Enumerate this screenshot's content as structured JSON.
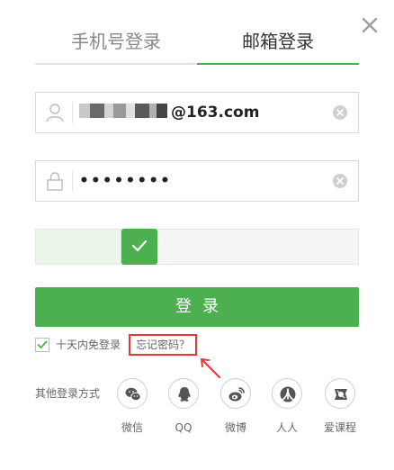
{
  "tabs": [
    {
      "label": "手机号登录",
      "active": false
    },
    {
      "label": "邮箱登录",
      "active": true
    }
  ],
  "email_field": {
    "value": "@163.com",
    "masked_prefix": true
  },
  "password_field": {
    "value": "••••••••"
  },
  "slider": {
    "verified": true
  },
  "login_button": {
    "label": "登录"
  },
  "remember": {
    "label": "十天内免登录",
    "checked": true
  },
  "forgot": {
    "label": "忘记密码？"
  },
  "other_login": {
    "label": "其他登录方式",
    "providers": [
      {
        "label": "微信",
        "icon": "wechat-icon"
      },
      {
        "label": "QQ",
        "icon": "qq-icon"
      },
      {
        "label": "微博",
        "icon": "weibo-icon"
      },
      {
        "label": "人人",
        "icon": "renren-icon"
      },
      {
        "label": "爱课程",
        "icon": "aikecheng-icon"
      }
    ]
  },
  "colors": {
    "accent": "#4caf50",
    "highlight": "#e53935"
  }
}
